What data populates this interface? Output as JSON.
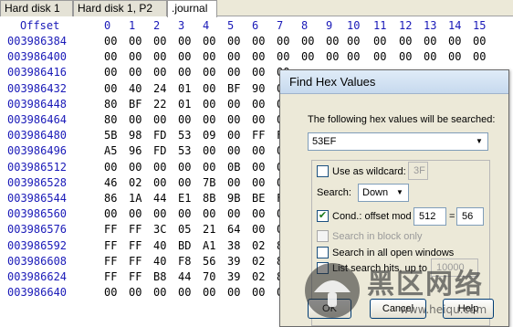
{
  "tabs": [
    "Hard disk 1",
    "Hard disk 1, P2",
    ".journal"
  ],
  "header": {
    "offset_label": "Offset",
    "columns": [
      "0",
      "1",
      "2",
      "3",
      "4",
      "5",
      "6",
      "7",
      "8",
      "9",
      "10",
      "11",
      "12",
      "13",
      "14",
      "15"
    ]
  },
  "rows": [
    {
      "offset": "003986384",
      "bytes": [
        "00",
        "00",
        "00",
        "00",
        "00",
        "00",
        "00",
        "00",
        "00",
        "00",
        "00",
        "00",
        "00",
        "00",
        "00",
        "00"
      ]
    },
    {
      "offset": "003986400",
      "bytes": [
        "00",
        "00",
        "00",
        "00",
        "00",
        "00",
        "00",
        "00",
        "00",
        "00",
        "00",
        "00",
        "00",
        "00",
        "00",
        "00"
      ]
    },
    {
      "offset": "003986416",
      "bytes": [
        "00",
        "00",
        "00",
        "00",
        "00",
        "00",
        "00",
        "00"
      ]
    },
    {
      "offset": "003986432",
      "bytes": [
        "00",
        "40",
        "24",
        "01",
        "00",
        "BF",
        "90",
        "04"
      ]
    },
    {
      "offset": "003986448",
      "bytes": [
        "80",
        "BF",
        "22",
        "01",
        "00",
        "00",
        "00",
        "00"
      ]
    },
    {
      "offset": "003986464",
      "bytes": [
        "80",
        "00",
        "00",
        "00",
        "00",
        "00",
        "00",
        "00"
      ]
    },
    {
      "offset": "003986480",
      "bytes": [
        "5B",
        "98",
        "FD",
        "53",
        "09",
        "00",
        "FF",
        "FF"
      ]
    },
    {
      "offset": "003986496",
      "bytes": [
        "A5",
        "96",
        "FD",
        "53",
        "00",
        "00",
        "00",
        "00"
      ]
    },
    {
      "offset": "003986512",
      "bytes": [
        "00",
        "00",
        "00",
        "00",
        "00",
        "0B",
        "00",
        "00"
      ]
    },
    {
      "offset": "003986528",
      "bytes": [
        "46",
        "02",
        "00",
        "00",
        "7B",
        "00",
        "00",
        "00"
      ]
    },
    {
      "offset": "003986544",
      "bytes": [
        "86",
        "1A",
        "44",
        "E1",
        "8B",
        "9B",
        "BE",
        "FF"
      ]
    },
    {
      "offset": "003986560",
      "bytes": [
        "00",
        "00",
        "00",
        "00",
        "00",
        "00",
        "00",
        "00"
      ]
    },
    {
      "offset": "003986576",
      "bytes": [
        "FF",
        "FF",
        "3C",
        "05",
        "21",
        "64",
        "00",
        "00"
      ]
    },
    {
      "offset": "003986592",
      "bytes": [
        "FF",
        "FF",
        "40",
        "BD",
        "A1",
        "38",
        "02",
        "80"
      ]
    },
    {
      "offset": "003986608",
      "bytes": [
        "FF",
        "FF",
        "40",
        "F8",
        "56",
        "39",
        "02",
        "80"
      ]
    },
    {
      "offset": "003986624",
      "bytes": [
        "FF",
        "FF",
        "B8",
        "44",
        "70",
        "39",
        "02",
        "80"
      ]
    },
    {
      "offset": "003986640",
      "bytes": [
        "00",
        "00",
        "00",
        "00",
        "00",
        "00",
        "00",
        "00"
      ]
    }
  ],
  "dialog": {
    "title": "Find Hex Values",
    "description": "The following hex values will be searched:",
    "search_value": "53EF",
    "use_as_wildcard_label": "Use as wildcard:",
    "use_as_wildcard_checked": false,
    "wildcard_value": "3F",
    "search_label": "Search:",
    "search_direction": "Down",
    "cond_label": "Cond.: offset mod",
    "cond_checked": true,
    "cond_mod_value": "512",
    "cond_equals": "=",
    "cond_result_value": "56",
    "search_in_block_label": "Search in block only",
    "search_all_windows_label": "Search in all open windows",
    "list_hits_label": "List search hits, up to",
    "list_hits_value": "10000",
    "ok_label": "OK",
    "cancel_label": "Cancel",
    "help_label": "Help"
  },
  "watermark": {
    "cn_text": "黑区网络",
    "url": "www.heiqu.com"
  }
}
